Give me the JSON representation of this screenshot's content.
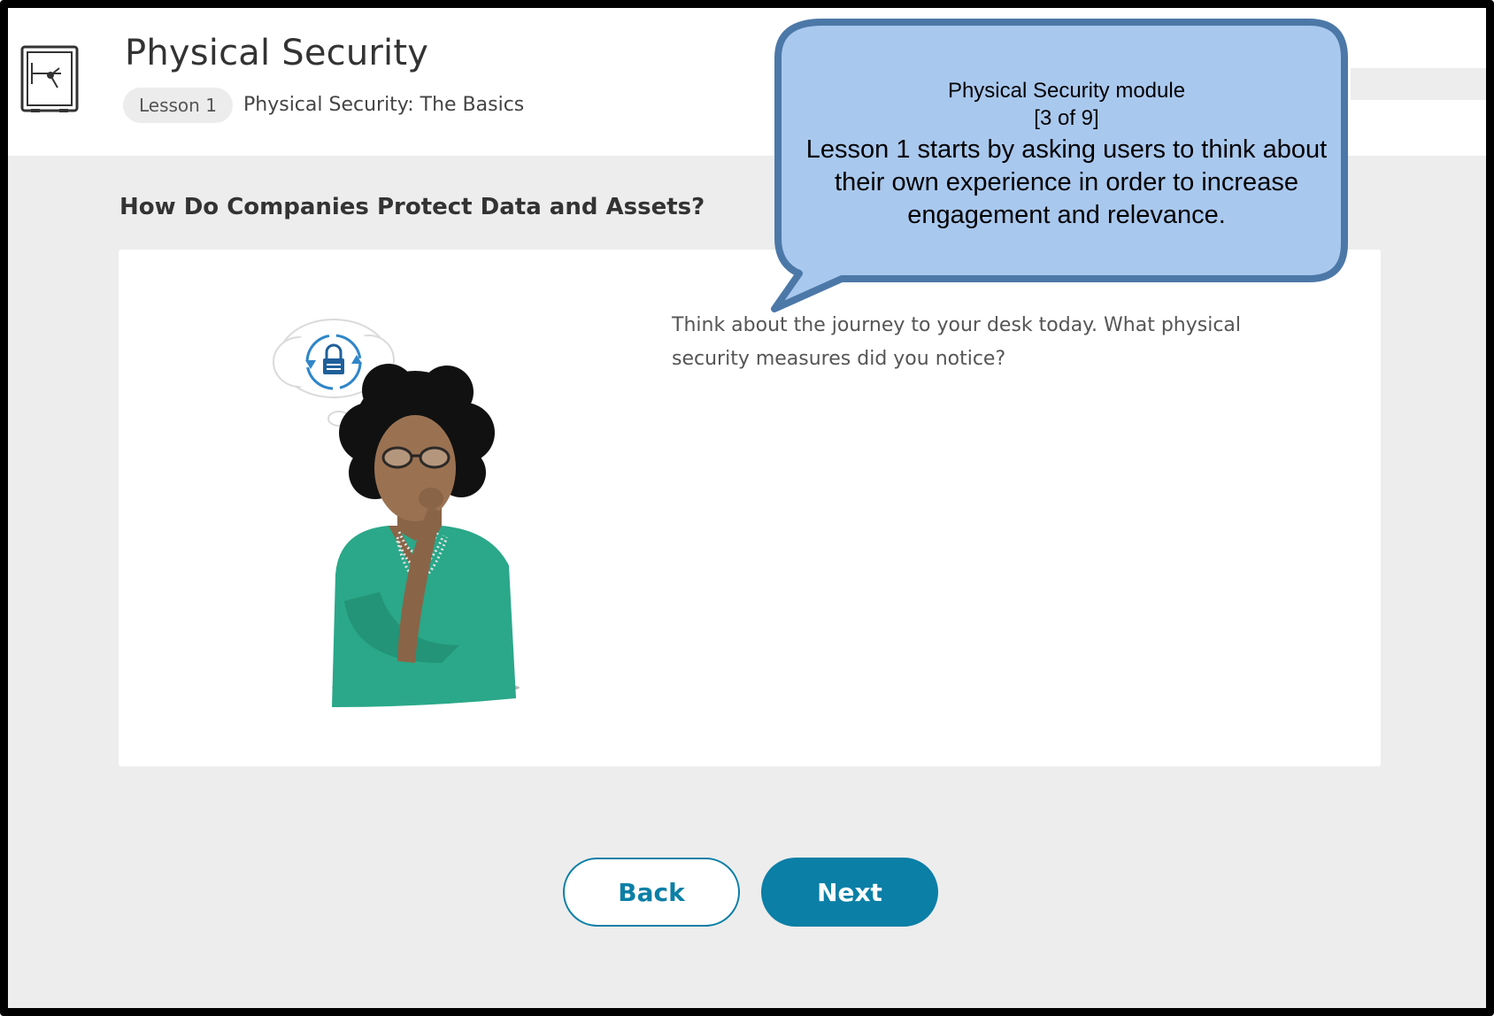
{
  "header": {
    "title": "Physical Security",
    "lesson_badge": "Lesson 1",
    "lesson_title": "Physical Security: The Basics"
  },
  "main": {
    "question": "How Do Companies Protect Data and Assets?",
    "prompt": "Think about the journey to your desk today. What physical security measures did you notice?"
  },
  "footer": {
    "back_label": "Back",
    "next_label": "Next"
  },
  "callout": {
    "module": "Physical Security module",
    "count": "[3 of 9]",
    "body": "Lesson 1 starts by asking users to think about their own experience in order to increase engagement and relevance."
  },
  "icons": {
    "header_icon": "safe-icon",
    "thought_icon": "lock-refresh-icon"
  },
  "colors": {
    "accent": "#0b7fa6",
    "callout_fill": "#a9c8ee",
    "callout_border": "#4c78a8",
    "shirt": "#2aa889"
  }
}
